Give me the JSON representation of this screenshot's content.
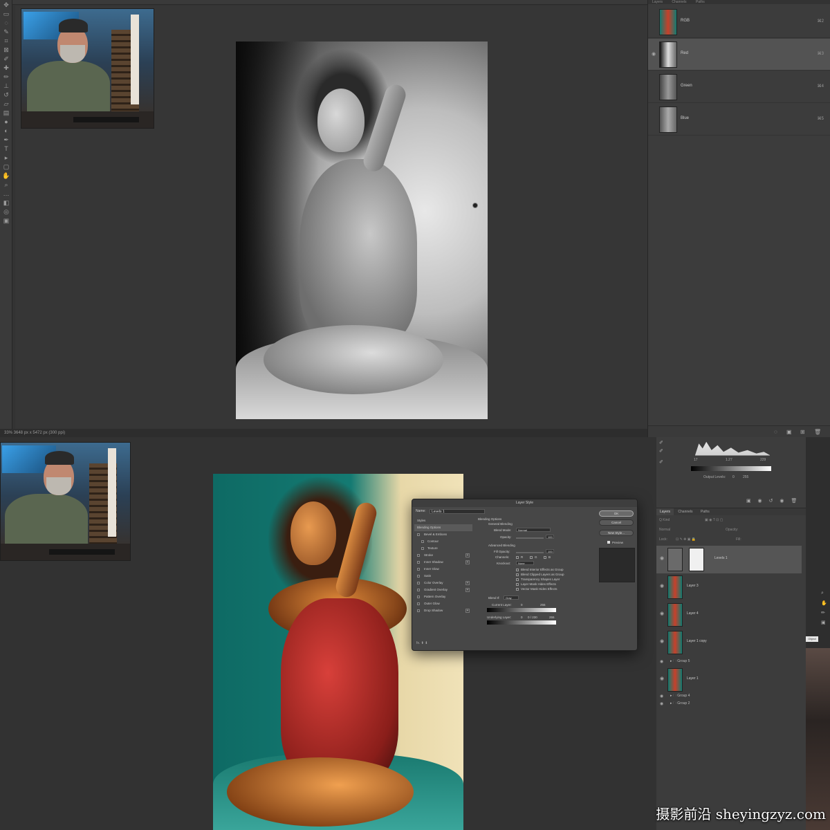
{
  "top": {
    "status_text": "33%   3648 px x 5472 px (300 ppi)",
    "panel_tabs": [
      "Layers",
      "Channels",
      "Paths"
    ],
    "channels": [
      {
        "name": "RGB",
        "shortcut": "⌘2"
      },
      {
        "name": "Red",
        "shortcut": "⌘3"
      },
      {
        "name": "Green",
        "shortcut": "⌘4"
      },
      {
        "name": "Blue",
        "shortcut": "⌘5"
      }
    ]
  },
  "properties": {
    "input_levels": [
      "17",
      "1.27",
      "229"
    ],
    "output_label": "Output Levels:",
    "output_levels": [
      "0",
      "255"
    ]
  },
  "layers": {
    "tabs": [
      "Layers",
      "Channels",
      "Paths"
    ],
    "kind_label": "Q Kind",
    "blend_label": "Normal",
    "opacity_label": "Opacity:",
    "lock_label": "Lock:",
    "fill_label": "Fill:",
    "rows": [
      {
        "name": "Levels 1"
      },
      {
        "name": "Layer 3"
      },
      {
        "name": "Layer 4"
      },
      {
        "name": "Layer 1 copy"
      }
    ],
    "group5": "Group 5",
    "layer1": "Layer 1",
    "group4": "Group 4",
    "group2": "Group 2"
  },
  "side_button": "Object",
  "dialog": {
    "title": "Layer Style",
    "name_label": "Name:",
    "name_value": "Levels 1",
    "styles": [
      {
        "label": "Styles",
        "header": true
      },
      {
        "label": "Blending Options",
        "selected": true
      },
      {
        "label": "Bevel & Emboss"
      },
      {
        "label": "Contour"
      },
      {
        "label": "Texture"
      },
      {
        "label": "Stroke",
        "plus": true
      },
      {
        "label": "Inner Shadow",
        "plus": true
      },
      {
        "label": "Inner Glow"
      },
      {
        "label": "Satin"
      },
      {
        "label": "Color Overlay",
        "plus": true
      },
      {
        "label": "Gradient Overlay",
        "plus": true
      },
      {
        "label": "Pattern Overlay"
      },
      {
        "label": "Outer Glow"
      },
      {
        "label": "Drop Shadow",
        "plus": true
      }
    ],
    "fx_label": "fx.  ⬆  ⬇",
    "blending_options": "Blending Options",
    "general_blending": "General Blending",
    "blend_mode_label": "Blend Mode:",
    "blend_mode_value": "Normal",
    "opacity_label": "Opacity:",
    "opacity_value": "100",
    "advanced_blending": "Advanced Blending",
    "fill_opacity_label": "Fill Opacity:",
    "fill_opacity_value": "100",
    "channels_label": "Channels:",
    "channels": [
      "R",
      "G",
      "B"
    ],
    "knockout_label": "Knockout:",
    "knockout_value": "None",
    "checks": [
      "Blend Interior Effects as Group",
      "Blend Clipped Layers as Group",
      "Transparency Shapes Layer",
      "Layer Mask Hides Effects",
      "Vector Mask Hides Effects"
    ],
    "blend_if_label": "Blend If:",
    "blend_if_value": "Gray",
    "current_layer_label": "Current Layer:",
    "current_layer_values": [
      "0",
      "255"
    ],
    "underlying_label": "Underlying Layer:",
    "underlying_values": [
      "0",
      "0 / 230",
      "255"
    ],
    "buttons": {
      "ok": "OK",
      "cancel": "Cancel",
      "new_style": "New Style...",
      "preview": "Preview"
    }
  },
  "watermark": "摄影前沿 sheyingzyz.com"
}
